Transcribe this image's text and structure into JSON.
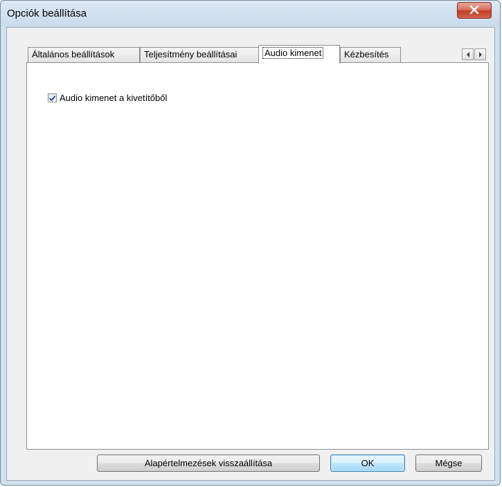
{
  "window": {
    "title": "Opciók beállítása"
  },
  "tabs": [
    {
      "label": "Általános beállítások",
      "active": false
    },
    {
      "label": "Teljesítmény beállításai",
      "active": false
    },
    {
      "label": "Audio kimenet",
      "active": true
    },
    {
      "label": "Kézbesítés",
      "active": false
    }
  ],
  "panel": {
    "audio_checkbox": {
      "label": "Audio kimenet a kivetítőből",
      "checked": true
    }
  },
  "buttons": {
    "reset_label": "Alapértelmezések visszaállítása",
    "ok_label": "OK",
    "cancel_label": "Mégse"
  },
  "icons": {
    "close": "close-icon",
    "scroll_left": "chevron-left-icon",
    "scroll_right": "chevron-right-icon",
    "check": "checkmark-icon"
  },
  "colors": {
    "close_button": "#c43c25",
    "titlebar": "#cfe0ee",
    "default_button_border": "#3c7fb1"
  }
}
